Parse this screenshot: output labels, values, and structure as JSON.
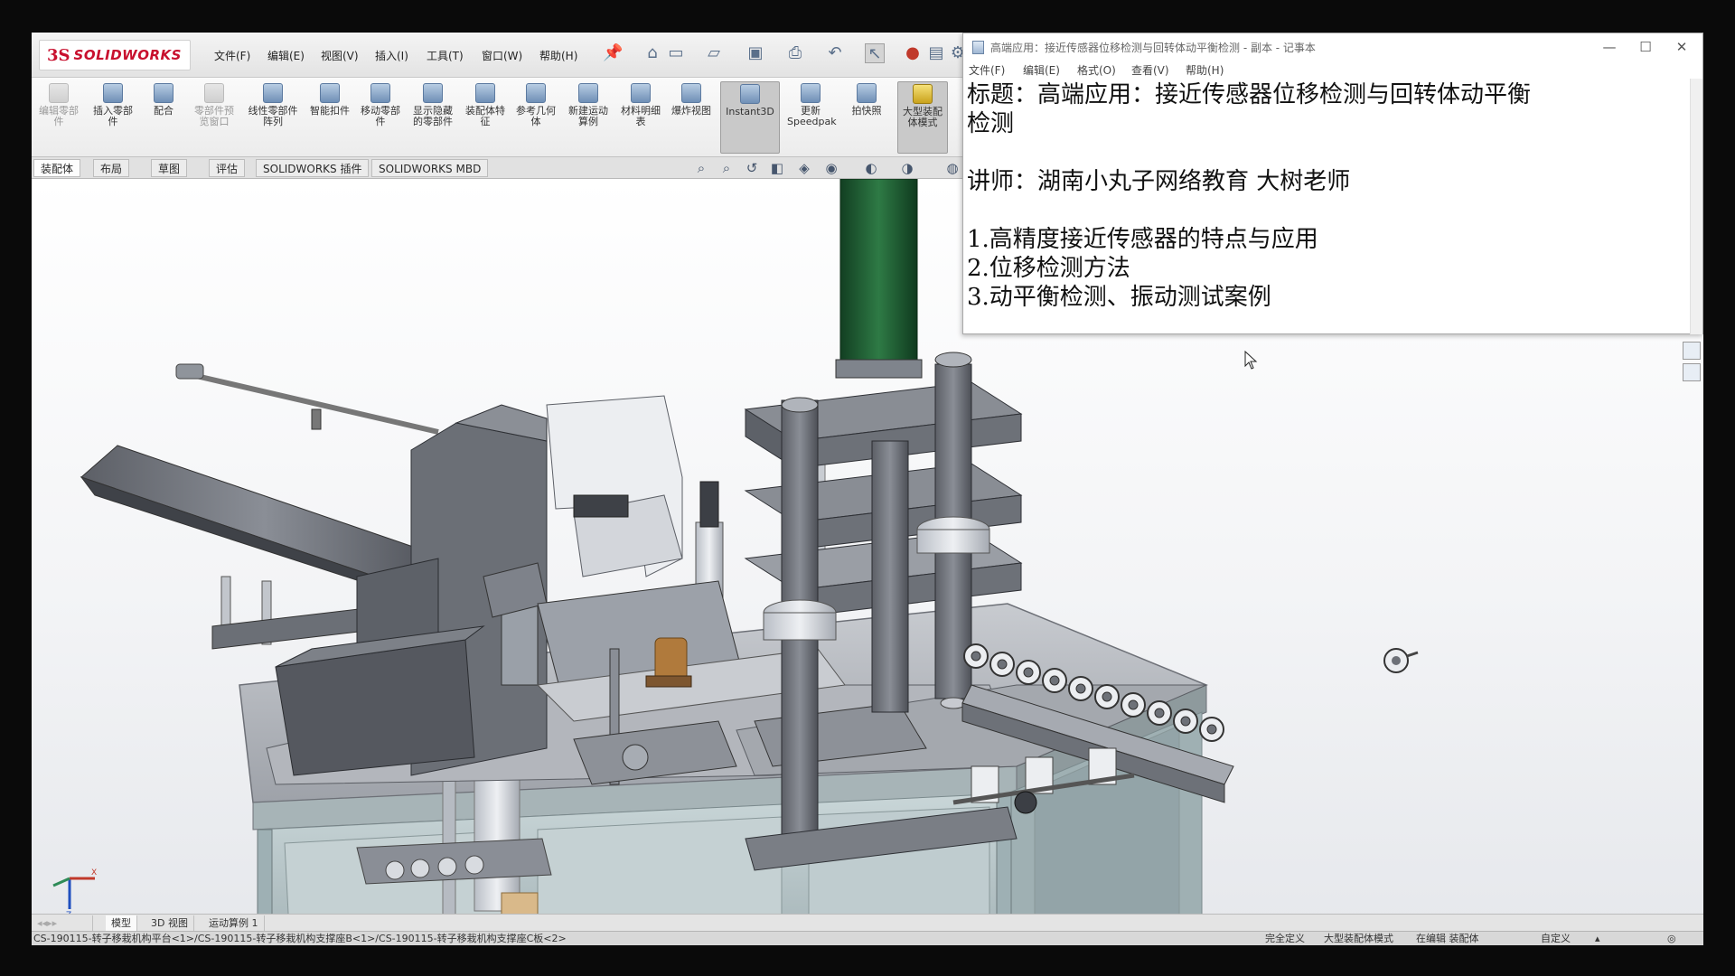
{
  "solidworks": {
    "logo_ds": "3S",
    "logo_name": "SOLIDWORKS",
    "menu": [
      "文件(F)",
      "编辑(E)",
      "视图(V)",
      "插入(I)",
      "工具(T)",
      "窗口(W)",
      "帮助(H)"
    ],
    "ribbon": [
      {
        "label": "编辑零部件",
        "dim": true
      },
      {
        "label": "插入零部件",
        "dim": false
      },
      {
        "label": "配合",
        "dim": false
      },
      {
        "label": "零部件预览窗口",
        "dim": true
      },
      {
        "label": "线性零部件阵列",
        "dim": false
      },
      {
        "label": "智能扣件",
        "dim": false
      },
      {
        "label": "移动零部件",
        "dim": false
      },
      {
        "label": "显示隐藏的零部件",
        "dim": false
      },
      {
        "label": "装配体特征",
        "dim": false
      },
      {
        "label": "参考几何体",
        "dim": false
      },
      {
        "label": "新建运动算例",
        "dim": false
      },
      {
        "label": "材料明细表",
        "dim": false
      },
      {
        "label": "爆炸视图",
        "dim": false
      },
      {
        "label": "Instant3D",
        "dim": false,
        "active": true
      },
      {
        "label": "更新Speedpak",
        "dim": false
      },
      {
        "label": "拍快照",
        "dim": false
      },
      {
        "label": "大型装配体模式",
        "dim": false,
        "active": true
      }
    ],
    "command_tabs": [
      "装配体",
      "布局",
      "草图",
      "评估",
      "SOLIDWORKS 插件",
      "SOLIDWORKS MBD"
    ],
    "bottom_tabs": [
      "模型",
      "3D 视图",
      "运动算例 1"
    ],
    "status_left": "CS-190115-转子移栽机构平台<1>/CS-190115-转子移栽机构支撑座B<1>/CS-190115-转子移栽机构支撑座C板<2>",
    "status_items": [
      "完全定义",
      "大型装配体模式",
      "在编辑 装配体",
      "自定义"
    ]
  },
  "notepad": {
    "title": "高端应用：接近传感器位移检测与回转体动平衡检测 - 副本 - 记事本",
    "menu": [
      "文件(F)",
      "编辑(E)",
      "格式(O)",
      "查看(V)",
      "帮助(H)"
    ],
    "lines": [
      "标题：高端应用：接近传感器位移检测与回转体动平衡",
      "检测",
      "",
      "讲师：湖南小丸子网络教育        大树老师",
      "",
      "1.高精度接近传感器的特点与应用",
      "2.位移检测方法",
      "3.动平衡检测、振动测试案例"
    ]
  }
}
